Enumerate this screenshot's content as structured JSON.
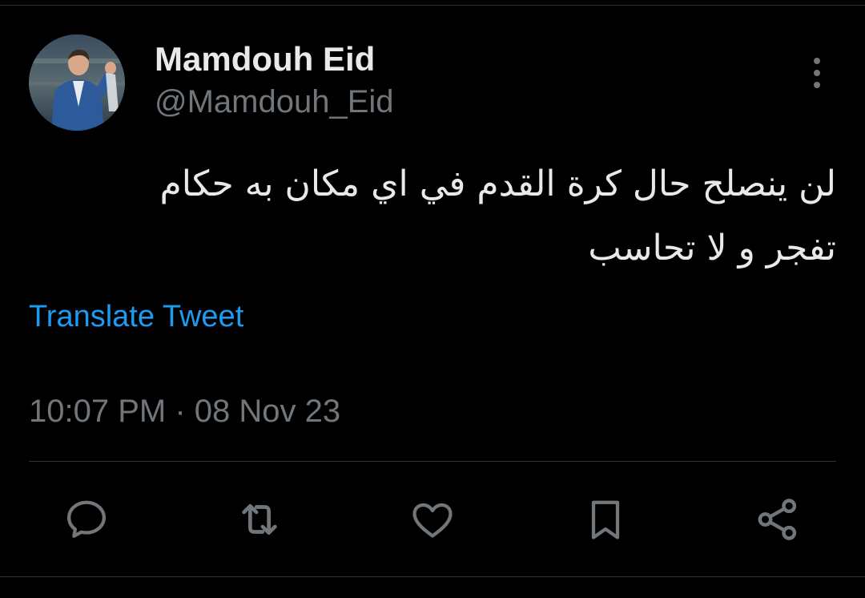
{
  "tweet": {
    "display_name": "Mamdouh Eid",
    "handle": "@Mamdouh_Eid",
    "text_line1": "لن ينصلح حال كرة القدم في اي مكان به حكام",
    "text_line2": "تفجر و لا تحاسب",
    "translate_label": "Translate Tweet",
    "timestamp": "10:07 PM · 08 Nov 23"
  },
  "icons": {
    "more": "more-vertical-icon",
    "reply": "reply-icon",
    "retweet": "retweet-icon",
    "like": "heart-icon",
    "bookmark": "bookmark-icon",
    "share": "share-icon"
  },
  "colors": {
    "background": "#000000",
    "primary_text": "#e7e9ea",
    "secondary_text": "#71767b",
    "link": "#1d9bf0",
    "divider": "#2f3336"
  }
}
